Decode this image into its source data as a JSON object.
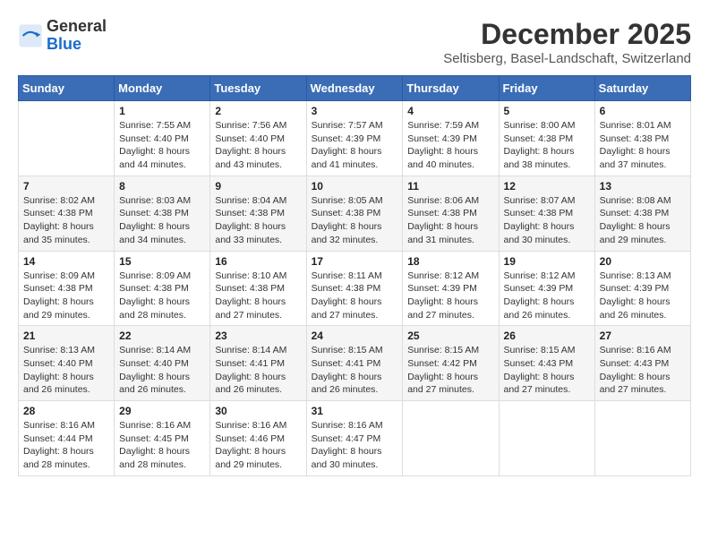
{
  "logo": {
    "general": "General",
    "blue": "Blue"
  },
  "header": {
    "month": "December 2025",
    "location": "Seltisberg, Basel-Landschaft, Switzerland"
  },
  "weekdays": [
    "Sunday",
    "Monday",
    "Tuesday",
    "Wednesday",
    "Thursday",
    "Friday",
    "Saturday"
  ],
  "weeks": [
    [
      {
        "day": "",
        "info": ""
      },
      {
        "day": "1",
        "info": "Sunrise: 7:55 AM\nSunset: 4:40 PM\nDaylight: 8 hours\nand 44 minutes."
      },
      {
        "day": "2",
        "info": "Sunrise: 7:56 AM\nSunset: 4:40 PM\nDaylight: 8 hours\nand 43 minutes."
      },
      {
        "day": "3",
        "info": "Sunrise: 7:57 AM\nSunset: 4:39 PM\nDaylight: 8 hours\nand 41 minutes."
      },
      {
        "day": "4",
        "info": "Sunrise: 7:59 AM\nSunset: 4:39 PM\nDaylight: 8 hours\nand 40 minutes."
      },
      {
        "day": "5",
        "info": "Sunrise: 8:00 AM\nSunset: 4:38 PM\nDaylight: 8 hours\nand 38 minutes."
      },
      {
        "day": "6",
        "info": "Sunrise: 8:01 AM\nSunset: 4:38 PM\nDaylight: 8 hours\nand 37 minutes."
      }
    ],
    [
      {
        "day": "7",
        "info": "Sunrise: 8:02 AM\nSunset: 4:38 PM\nDaylight: 8 hours\nand 35 minutes."
      },
      {
        "day": "8",
        "info": "Sunrise: 8:03 AM\nSunset: 4:38 PM\nDaylight: 8 hours\nand 34 minutes."
      },
      {
        "day": "9",
        "info": "Sunrise: 8:04 AM\nSunset: 4:38 PM\nDaylight: 8 hours\nand 33 minutes."
      },
      {
        "day": "10",
        "info": "Sunrise: 8:05 AM\nSunset: 4:38 PM\nDaylight: 8 hours\nand 32 minutes."
      },
      {
        "day": "11",
        "info": "Sunrise: 8:06 AM\nSunset: 4:38 PM\nDaylight: 8 hours\nand 31 minutes."
      },
      {
        "day": "12",
        "info": "Sunrise: 8:07 AM\nSunset: 4:38 PM\nDaylight: 8 hours\nand 30 minutes."
      },
      {
        "day": "13",
        "info": "Sunrise: 8:08 AM\nSunset: 4:38 PM\nDaylight: 8 hours\nand 29 minutes."
      }
    ],
    [
      {
        "day": "14",
        "info": "Sunrise: 8:09 AM\nSunset: 4:38 PM\nDaylight: 8 hours\nand 29 minutes."
      },
      {
        "day": "15",
        "info": "Sunrise: 8:09 AM\nSunset: 4:38 PM\nDaylight: 8 hours\nand 28 minutes."
      },
      {
        "day": "16",
        "info": "Sunrise: 8:10 AM\nSunset: 4:38 PM\nDaylight: 8 hours\nand 27 minutes."
      },
      {
        "day": "17",
        "info": "Sunrise: 8:11 AM\nSunset: 4:38 PM\nDaylight: 8 hours\nand 27 minutes."
      },
      {
        "day": "18",
        "info": "Sunrise: 8:12 AM\nSunset: 4:39 PM\nDaylight: 8 hours\nand 27 minutes."
      },
      {
        "day": "19",
        "info": "Sunrise: 8:12 AM\nSunset: 4:39 PM\nDaylight: 8 hours\nand 26 minutes."
      },
      {
        "day": "20",
        "info": "Sunrise: 8:13 AM\nSunset: 4:39 PM\nDaylight: 8 hours\nand 26 minutes."
      }
    ],
    [
      {
        "day": "21",
        "info": "Sunrise: 8:13 AM\nSunset: 4:40 PM\nDaylight: 8 hours\nand 26 minutes."
      },
      {
        "day": "22",
        "info": "Sunrise: 8:14 AM\nSunset: 4:40 PM\nDaylight: 8 hours\nand 26 minutes."
      },
      {
        "day": "23",
        "info": "Sunrise: 8:14 AM\nSunset: 4:41 PM\nDaylight: 8 hours\nand 26 minutes."
      },
      {
        "day": "24",
        "info": "Sunrise: 8:15 AM\nSunset: 4:41 PM\nDaylight: 8 hours\nand 26 minutes."
      },
      {
        "day": "25",
        "info": "Sunrise: 8:15 AM\nSunset: 4:42 PM\nDaylight: 8 hours\nand 27 minutes."
      },
      {
        "day": "26",
        "info": "Sunrise: 8:15 AM\nSunset: 4:43 PM\nDaylight: 8 hours\nand 27 minutes."
      },
      {
        "day": "27",
        "info": "Sunrise: 8:16 AM\nSunset: 4:43 PM\nDaylight: 8 hours\nand 27 minutes."
      }
    ],
    [
      {
        "day": "28",
        "info": "Sunrise: 8:16 AM\nSunset: 4:44 PM\nDaylight: 8 hours\nand 28 minutes."
      },
      {
        "day": "29",
        "info": "Sunrise: 8:16 AM\nSunset: 4:45 PM\nDaylight: 8 hours\nand 28 minutes."
      },
      {
        "day": "30",
        "info": "Sunrise: 8:16 AM\nSunset: 4:46 PM\nDaylight: 8 hours\nand 29 minutes."
      },
      {
        "day": "31",
        "info": "Sunrise: 8:16 AM\nSunset: 4:47 PM\nDaylight: 8 hours\nand 30 minutes."
      },
      {
        "day": "",
        "info": ""
      },
      {
        "day": "",
        "info": ""
      },
      {
        "day": "",
        "info": ""
      }
    ]
  ]
}
